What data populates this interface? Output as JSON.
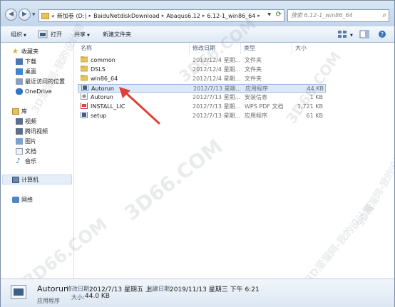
{
  "address": {
    "crumbs": [
      "«",
      "新加卷 (D:)",
      "BaiduNetdiskDownload",
      "Abaqus6.12",
      "6.12-1_win86_64"
    ],
    "search_placeholder": "搜索 6.12-1_win86_64"
  },
  "toolbar": {
    "organize": "组织",
    "open": "打开",
    "share": "共享",
    "new_folder": "新建文件夹"
  },
  "columns": {
    "name": "名称",
    "date": "修改日期",
    "type": "类型",
    "size": "大小"
  },
  "files": [
    {
      "name": "common",
      "date": "2012/12/4 星期...",
      "type": "文件夹",
      "size": "",
      "icon": "folder-icon"
    },
    {
      "name": "DSLS",
      "date": "2012/12/4 星期...",
      "type": "文件夹",
      "size": "",
      "icon": "folder-icon"
    },
    {
      "name": "win86_64",
      "date": "2012/12/4 星期...",
      "type": "文件夹",
      "size": "",
      "icon": "folder-icon"
    },
    {
      "name": "Autorun",
      "date": "2012/7/13 星期...",
      "type": "应用程序",
      "size": "44 KB",
      "icon": "application-icon"
    },
    {
      "name": "Autorun",
      "date": "2012/7/13 星期...",
      "type": "安装信息",
      "size": "1 KB",
      "icon": "setup-info-icon"
    },
    {
      "name": "INSTALL_LIC",
      "date": "2012/7/13 星期...",
      "type": "WPS PDF 文档",
      "size": "1,721 KB",
      "icon": "pdf-icon"
    },
    {
      "name": "setup",
      "date": "2012/7/13 星期...",
      "type": "应用程序",
      "size": "61 KB",
      "icon": "application-icon"
    }
  ],
  "nav": {
    "favorites": "收藏夹",
    "downloads": "下载",
    "desktop": "桌面",
    "recent": "最近访问的位置",
    "onedrive": "OneDrive",
    "libraries": "库",
    "videos": "视频",
    "tencent_video": "腾讯视频",
    "pictures": "图片",
    "documents": "文档",
    "music": "音乐",
    "computer": "计算机",
    "network": "网络"
  },
  "details": {
    "name": "Autorun",
    "type": "应用程序",
    "modified_label": "修改日期:",
    "modified_value": "2012/7/13 星期五 上...",
    "created_label": "创建日期:",
    "created_value": "2019/11/13 星期三 下午 6:21",
    "size_label": "大小:",
    "size_value": "44.0 KB"
  },
  "watermarks": [
    "3D66.COM",
    "3D66.COM",
    "3D66.COM",
    "3D66.COM",
    "3D溜溜网-我的设计网",
    "3D溜溜网-我的设计网",
    "3D溜溜网-我的设计网"
  ],
  "colors": {
    "accent": "#dbe8f8",
    "arrow": "#e0403a"
  }
}
